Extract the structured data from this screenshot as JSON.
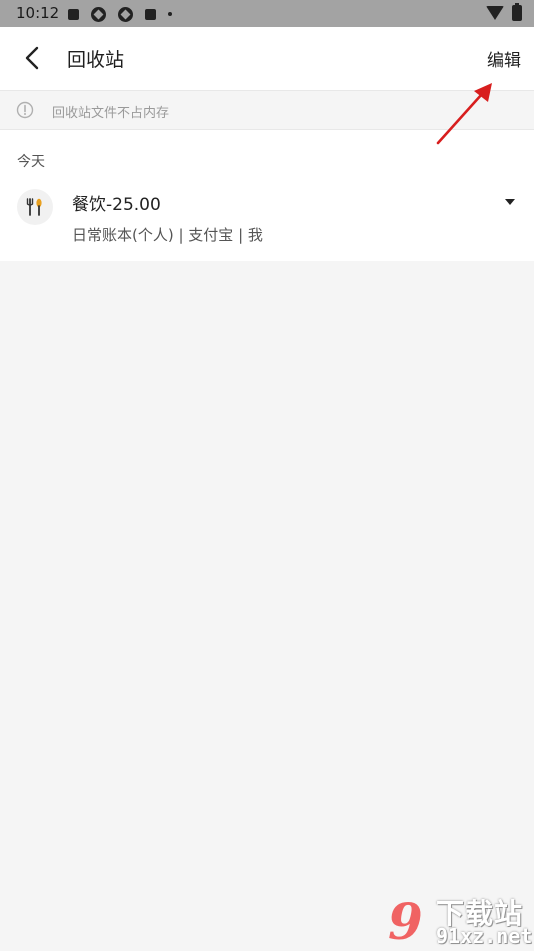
{
  "status_bar": {
    "time": "10:12"
  },
  "app_bar": {
    "title": "回收站",
    "edit_label": "编辑"
  },
  "notice": {
    "text": "回收站文件不占内存"
  },
  "list": {
    "date_header": "今天",
    "records": [
      {
        "title": "餐饮-25.00",
        "subtitle": "日常账本(个人) | 支付宝 | 我",
        "icon": "utensils-icon"
      }
    ]
  },
  "watermark": {
    "logo": "9",
    "title": "下载站",
    "url": "91xz.net"
  },
  "colors": {
    "annotation_arrow": "#e02020",
    "background": "#f5f5f5"
  }
}
